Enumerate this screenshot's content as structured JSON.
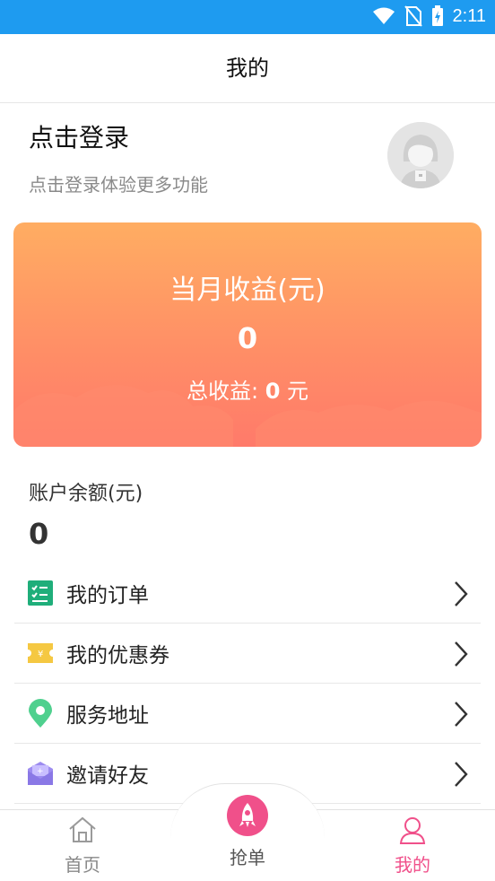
{
  "status_bar": {
    "time": "2:11",
    "icons": [
      "wifi-icon",
      "no-sim-icon",
      "battery-charging-icon"
    ]
  },
  "header": {
    "title": "我的"
  },
  "login": {
    "title": "点击登录",
    "subtitle": "点击登录体验更多功能"
  },
  "earnings": {
    "month_label": "当月收益(元)",
    "month_value": "0",
    "total_prefix": "总收益: ",
    "total_value": "0",
    "total_unit": " 元"
  },
  "balance": {
    "label": "账户余额(元)",
    "value": "0"
  },
  "menu": {
    "items": [
      {
        "label": "我的订单",
        "icon": "order-list-icon"
      },
      {
        "label": "我的优惠券",
        "icon": "coupon-icon"
      },
      {
        "label": "服务地址",
        "icon": "location-pin-icon"
      },
      {
        "label": "邀请好友",
        "icon": "invite-envelope-icon"
      }
    ]
  },
  "tabs": {
    "home": "首页",
    "grab": "抢单",
    "mine": "我的"
  },
  "colors": {
    "status_bar": "#1e9bf0",
    "accent": "#f0508a",
    "card_top": "#ffad62",
    "card_bottom": "#ff7a6a"
  }
}
